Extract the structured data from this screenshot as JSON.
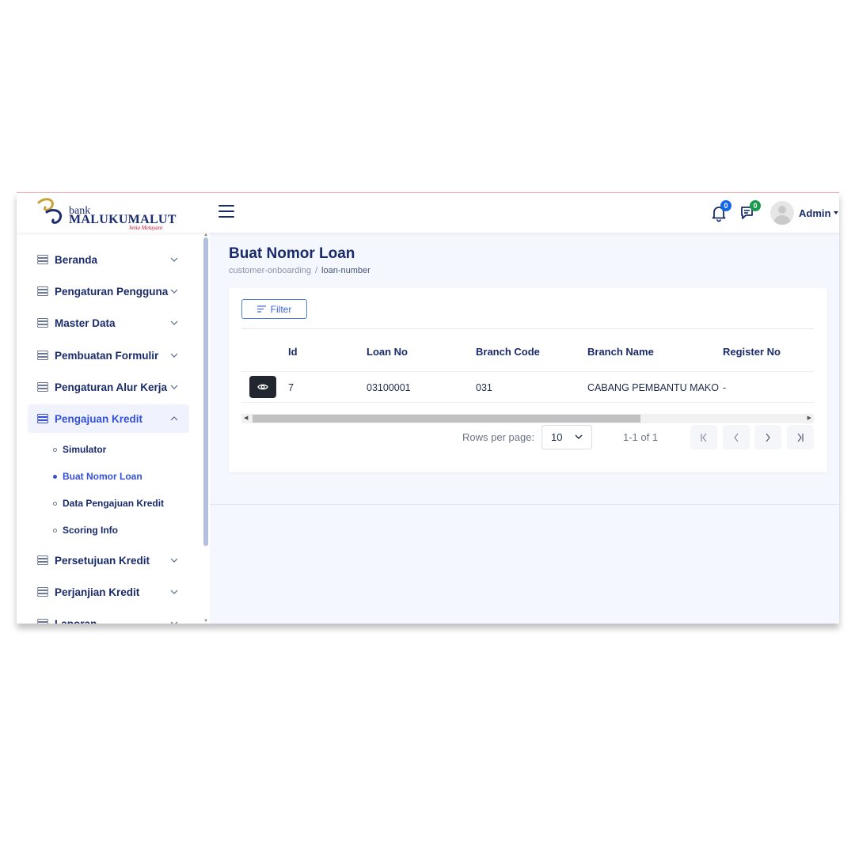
{
  "header": {
    "logo_bank": "bank",
    "logo_name": "MALUKUMALUT",
    "logo_tagline": "Setia Melayani",
    "notifications_count": "0",
    "messages_count": "0",
    "user_name": "Admin"
  },
  "sidebar": {
    "items": [
      {
        "label": "Beranda",
        "icon": "server-icon",
        "expanded": false
      },
      {
        "label": "Pengaturan Pengguna",
        "icon": "server-icon",
        "expanded": false
      },
      {
        "label": "Master Data",
        "icon": "server-icon",
        "expanded": false
      },
      {
        "label": "Pembuatan Formulir",
        "icon": "server-icon",
        "expanded": false
      },
      {
        "label": "Pengaturan Alur Kerja",
        "icon": "server-icon",
        "expanded": false
      },
      {
        "label": "Pengajuan Kredit",
        "icon": "server-icon",
        "expanded": true
      },
      {
        "label": "Persetujuan Kredit",
        "icon": "server-icon",
        "expanded": false
      },
      {
        "label": "Perjanjian Kredit",
        "icon": "server-icon",
        "expanded": false
      },
      {
        "label": "Laporan",
        "icon": "server-icon",
        "expanded": false
      }
    ],
    "subitems": [
      {
        "label": "Simulator",
        "active": false
      },
      {
        "label": "Buat Nomor Loan",
        "active": true
      },
      {
        "label": "Data Pengajuan Kredit",
        "active": false
      },
      {
        "label": "Scoring Info",
        "active": false
      }
    ]
  },
  "page": {
    "title": "Buat Nomor Loan",
    "breadcrumb": [
      "customer-onboarding",
      "loan-number"
    ],
    "breadcrumb_separator": "/"
  },
  "table": {
    "filter_label": "Filter",
    "columns": [
      "Id",
      "Loan No",
      "Branch Code",
      "Branch Name",
      "Register No"
    ],
    "rows": [
      [
        "7",
        "03100001",
        "031",
        "CABANG PEMBANTU MAKO",
        "-"
      ]
    ]
  },
  "pagination": {
    "rows_per_page_label": "Rows per page:",
    "rows_per_page": "10",
    "range": "1-1 of 1"
  },
  "colors": {
    "primary": "#1a2b6b",
    "accent": "#3450d8",
    "badge_blue": "#1467e8",
    "badge_green": "#1a9a4c"
  }
}
